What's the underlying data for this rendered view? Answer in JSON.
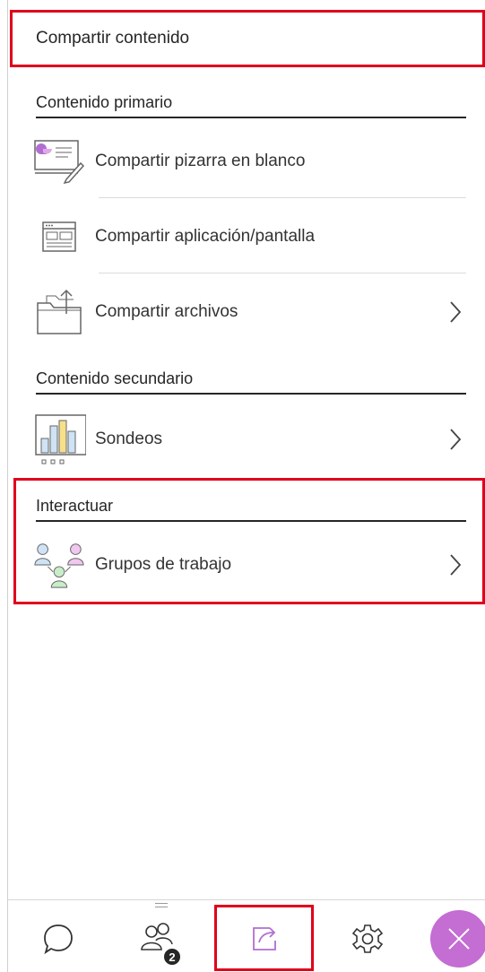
{
  "header": {
    "title": "Compartir contenido"
  },
  "sections": [
    {
      "title": "Contenido primario"
    },
    {
      "title": "Contenido secundario"
    },
    {
      "title": "Interactuar"
    }
  ],
  "primary_items": [
    {
      "label": "Compartir pizarra en blanco",
      "icon": "whiteboard-icon"
    },
    {
      "label": "Compartir aplicación/pantalla",
      "icon": "app-window-icon"
    },
    {
      "label": "Compartir archivos",
      "icon": "folder-upload-icon",
      "has_chevron": true
    }
  ],
  "secondary_items": [
    {
      "label": "Sondeos",
      "icon": "poll-chart-icon",
      "has_chevron": true
    }
  ],
  "interact_items": [
    {
      "label": "Grupos de trabajo",
      "icon": "breakout-groups-icon",
      "has_chevron": true
    }
  ],
  "footer": {
    "buttons": [
      "chat-icon",
      "participants-icon",
      "share-content-icon",
      "settings-icon",
      "close-icon"
    ],
    "participants_count": "2",
    "active": "share-content-icon"
  },
  "colors": {
    "highlight": "#e0001b",
    "accent": "#c46dd3",
    "text": "#262626"
  }
}
